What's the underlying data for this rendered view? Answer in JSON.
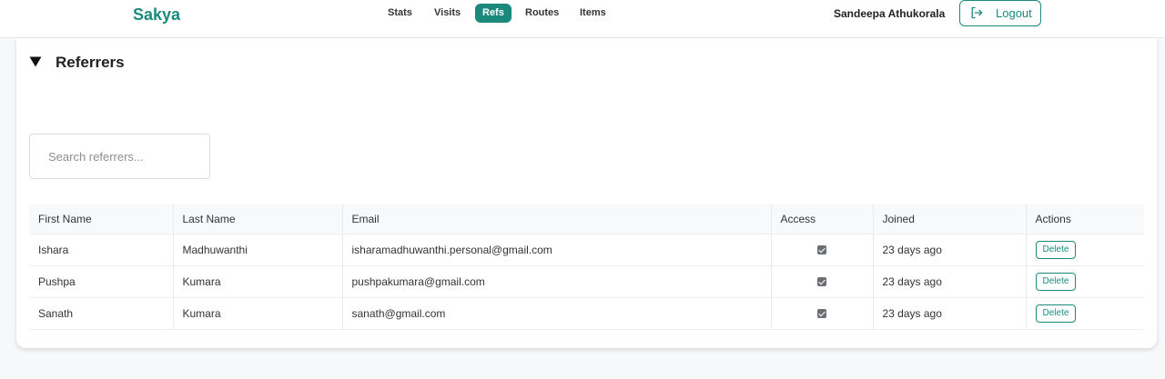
{
  "app": {
    "brand": "Sakya"
  },
  "nav": {
    "items": [
      {
        "label": "Stats"
      },
      {
        "label": "Visits"
      },
      {
        "label": "Refs",
        "active": true
      },
      {
        "label": "Routes"
      },
      {
        "label": "Items"
      }
    ]
  },
  "user": {
    "name": "Sandeepa Athukorala",
    "logout_label": "Logout"
  },
  "section": {
    "title": "Referrers",
    "toggle_icon": "caret-down-icon"
  },
  "search": {
    "placeholder": "Search referrers..."
  },
  "table": {
    "headers": [
      "First Name",
      "Last Name",
      "Email",
      "Access",
      "Joined",
      "Actions"
    ],
    "rows": [
      {
        "first": "Ishara",
        "last": "Madhuwanthi",
        "email": "isharamadhuwanthi.personal@gmail.com",
        "access": true,
        "joined": "23 days ago",
        "action": "Delete"
      },
      {
        "first": "Pushpa",
        "last": "Kumara",
        "email": "pushpakumara@gmail.com",
        "access": true,
        "joined": "23 days ago",
        "action": "Delete"
      },
      {
        "first": "Sanath",
        "last": "Kumara",
        "email": "sanath@gmail.com",
        "access": true,
        "joined": "23 days ago",
        "action": "Delete"
      }
    ]
  },
  "colors": {
    "accent": "#1b8a7d",
    "background": "#f7f8f9"
  }
}
